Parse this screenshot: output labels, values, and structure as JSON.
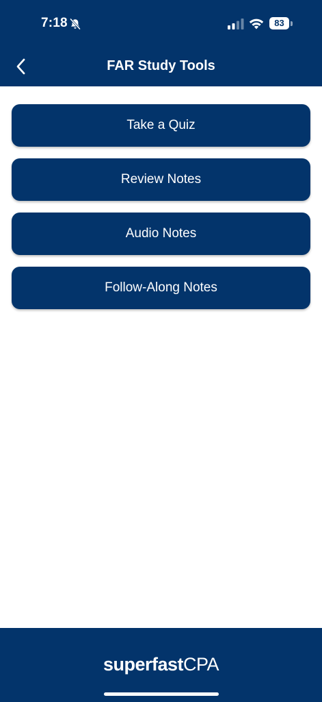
{
  "status_bar": {
    "time": "7:18",
    "battery_level": "83",
    "icons": [
      "bell-slash-icon",
      "cellular-signal-icon",
      "wifi-icon",
      "battery-icon"
    ]
  },
  "nav": {
    "back_icon": "chevron-left-icon",
    "title": "FAR Study Tools"
  },
  "tools": [
    {
      "label": "Take a Quiz"
    },
    {
      "label": "Review Notes"
    },
    {
      "label": "Audio Notes"
    },
    {
      "label": "Follow-Along Notes"
    }
  ],
  "footer": {
    "logo_bold": "superfast",
    "logo_light": "CPA"
  },
  "colors": {
    "brand_navy": "#03346b",
    "text_white": "#ffffff",
    "background": "#ffffff"
  }
}
